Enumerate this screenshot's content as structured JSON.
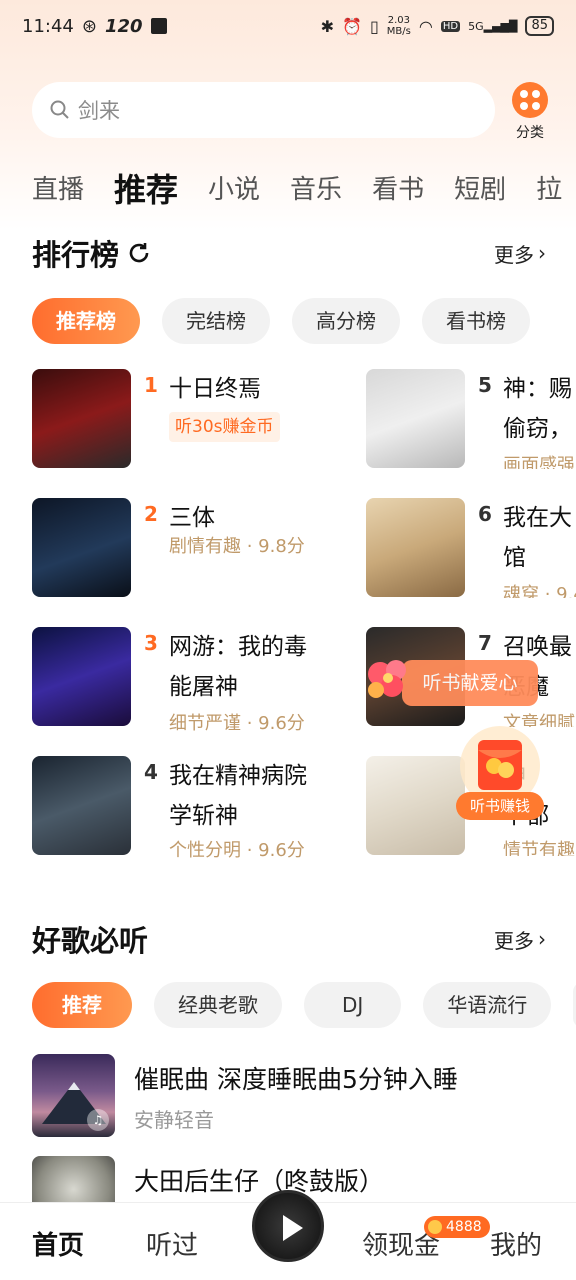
{
  "status": {
    "time": "11:44",
    "refresh": "120",
    "net_speed": "2.03",
    "net_unit": "MB/s",
    "hd": "HD",
    "signal": "5G",
    "battery": "85"
  },
  "search": {
    "placeholder": "剑来"
  },
  "category": {
    "label": "分类",
    "icon": "grid-dots-icon"
  },
  "tabs": [
    "直播",
    "推荐",
    "小说",
    "音乐",
    "看书",
    "短剧",
    "拉"
  ],
  "ranking": {
    "title": "排行榜",
    "more": "更多",
    "chips": [
      "推荐榜",
      "完结榜",
      "高分榜",
      "看书榜"
    ],
    "items": [
      {
        "rank": "1",
        "title": "十日终焉",
        "sub": "听30s赚金币"
      },
      {
        "rank": "2",
        "title": "三体",
        "sub": "剧情有趣 · 9.8分"
      },
      {
        "rank": "3",
        "title1": "网游：我的毒",
        "title2": "能屠神",
        "sub": "细节严谨 · 9.6分"
      },
      {
        "rank": "4",
        "title1": "我在精神病院",
        "title2": "学斩神",
        "sub": "个性分明 · 9.6分"
      },
      {
        "rank": "5",
        "title1": "神：赐",
        "title2": "偷窃，",
        "sub": "画面感强"
      },
      {
        "rank": "6",
        "title1": "我在大",
        "title2": "馆",
        "sub": "魂穿 · 9.4"
      },
      {
        "rank": "7",
        "title1": "召唤最",
        "title2": "恶魔",
        "sub": "文章细腻"
      },
      {
        "rank": "8",
        "title1": "神",
        "title2": "下都",
        "sub": "情节有趣"
      }
    ]
  },
  "floating": {
    "love": "听书献爱心",
    "money": "听书赚钱"
  },
  "songs": {
    "title": "好歌必听",
    "more": "更多",
    "chips": [
      "推荐",
      "经典老歌",
      "DJ",
      "华语流行"
    ],
    "items": [
      {
        "title": "催眠曲 深度睡眠曲5分钟入睡",
        "artist": "安静轻音"
      },
      {
        "title": "大田后生仔（咚鼓版）",
        "artist": ""
      }
    ]
  },
  "bottom_nav": {
    "home": "首页",
    "history": "听过",
    "cash": "领现金",
    "mine": "我的",
    "coins": "4888"
  },
  "colors": {
    "accent": "#ff6a22",
    "gold_text": "#c09a6a"
  }
}
